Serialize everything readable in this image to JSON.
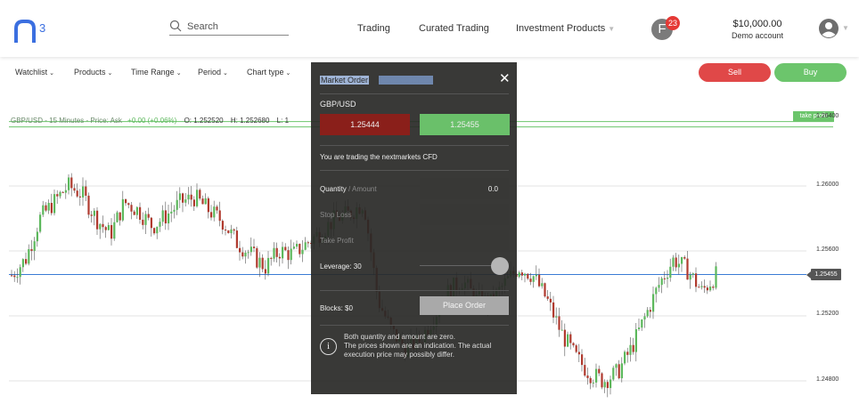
{
  "header": {
    "logo_text": "n3",
    "search_placeholder": "Search",
    "nav": [
      {
        "label": "Trading"
      },
      {
        "label": "Curated Trading"
      },
      {
        "label": "Investment Products",
        "has_caret": true
      }
    ],
    "avatar_initial": "F",
    "notification_count": "23",
    "balance": "$10,000.00",
    "account_type": "Demo account"
  },
  "toolbar": {
    "items": [
      "Watchlist",
      "Products",
      "Time Range",
      "Period",
      "Chart type"
    ],
    "sell_label": "Sell",
    "buy_label": "Buy"
  },
  "chart_legend": {
    "symbol": "GBP/USD - 15 Minutes - Price: Ask",
    "change": "+0.00 (+0.06%)",
    "open": "O: 1.252520",
    "high": "H: 1.252680",
    "low": "L: 1"
  },
  "chart_data": {
    "type": "candlestick",
    "title": "GBP/USD - 15 Minutes - Price: Ask",
    "y_ticks": [
      "1.26000",
      "1.25600",
      "1.25200",
      "1.24800"
    ],
    "y_tick_values": [
      1.26,
      1.256,
      1.252,
      1.248
    ],
    "take_profit_label": "take profit",
    "take_profit_value": 1.2638,
    "current_price": "1.25455",
    "current_price_value": 1.25455,
    "close_path": [
      1.2545,
      1.2555,
      1.258,
      1.259,
      1.26,
      1.2595,
      1.258,
      1.257,
      1.259,
      1.2585,
      1.2575,
      1.2582,
      1.259,
      1.2593,
      1.2585,
      1.2578,
      1.2565,
      1.2558,
      1.255,
      1.256,
      1.2558,
      1.2565,
      1.2572,
      1.258,
      1.2583,
      1.259,
      1.253,
      1.251,
      1.25,
      1.2505,
      1.252,
      1.2535,
      1.2542,
      1.253,
      1.2528,
      1.254,
      1.255,
      1.2545,
      1.253,
      1.251,
      1.2495,
      1.2485,
      1.248,
      1.2485,
      1.25,
      1.252,
      1.254,
      1.2555,
      1.2548,
      1.2535,
      1.2545
    ],
    "colors": {
      "up": "#5cb85c",
      "down": "#b03a2e",
      "current_line": "#3a7bd5",
      "take_profit_line": "#6cc56c"
    }
  },
  "order_panel": {
    "tab_market": "Market Order",
    "tab_pending": "Pending Order",
    "symbol": "GBP/USD",
    "bid": "1.25444",
    "ask": "1.25455",
    "trading_info": "You are trading the nextmarkets CFD",
    "quantity_label": "Quantity",
    "quantity_sep": " / ",
    "amount_label": "Amount",
    "quantity_value": "0.0",
    "stop_loss_label": "Stop Loss",
    "take_profit_label": "Take Profit",
    "leverage_label": "Leverage: 30",
    "blocks_label": "Blocks: $0",
    "place_order_label": "Place Order",
    "info_line1": "Both quantity and amount are zero.",
    "info_line2": "The prices shown are an indication. The actual execution price may possibly differ."
  }
}
